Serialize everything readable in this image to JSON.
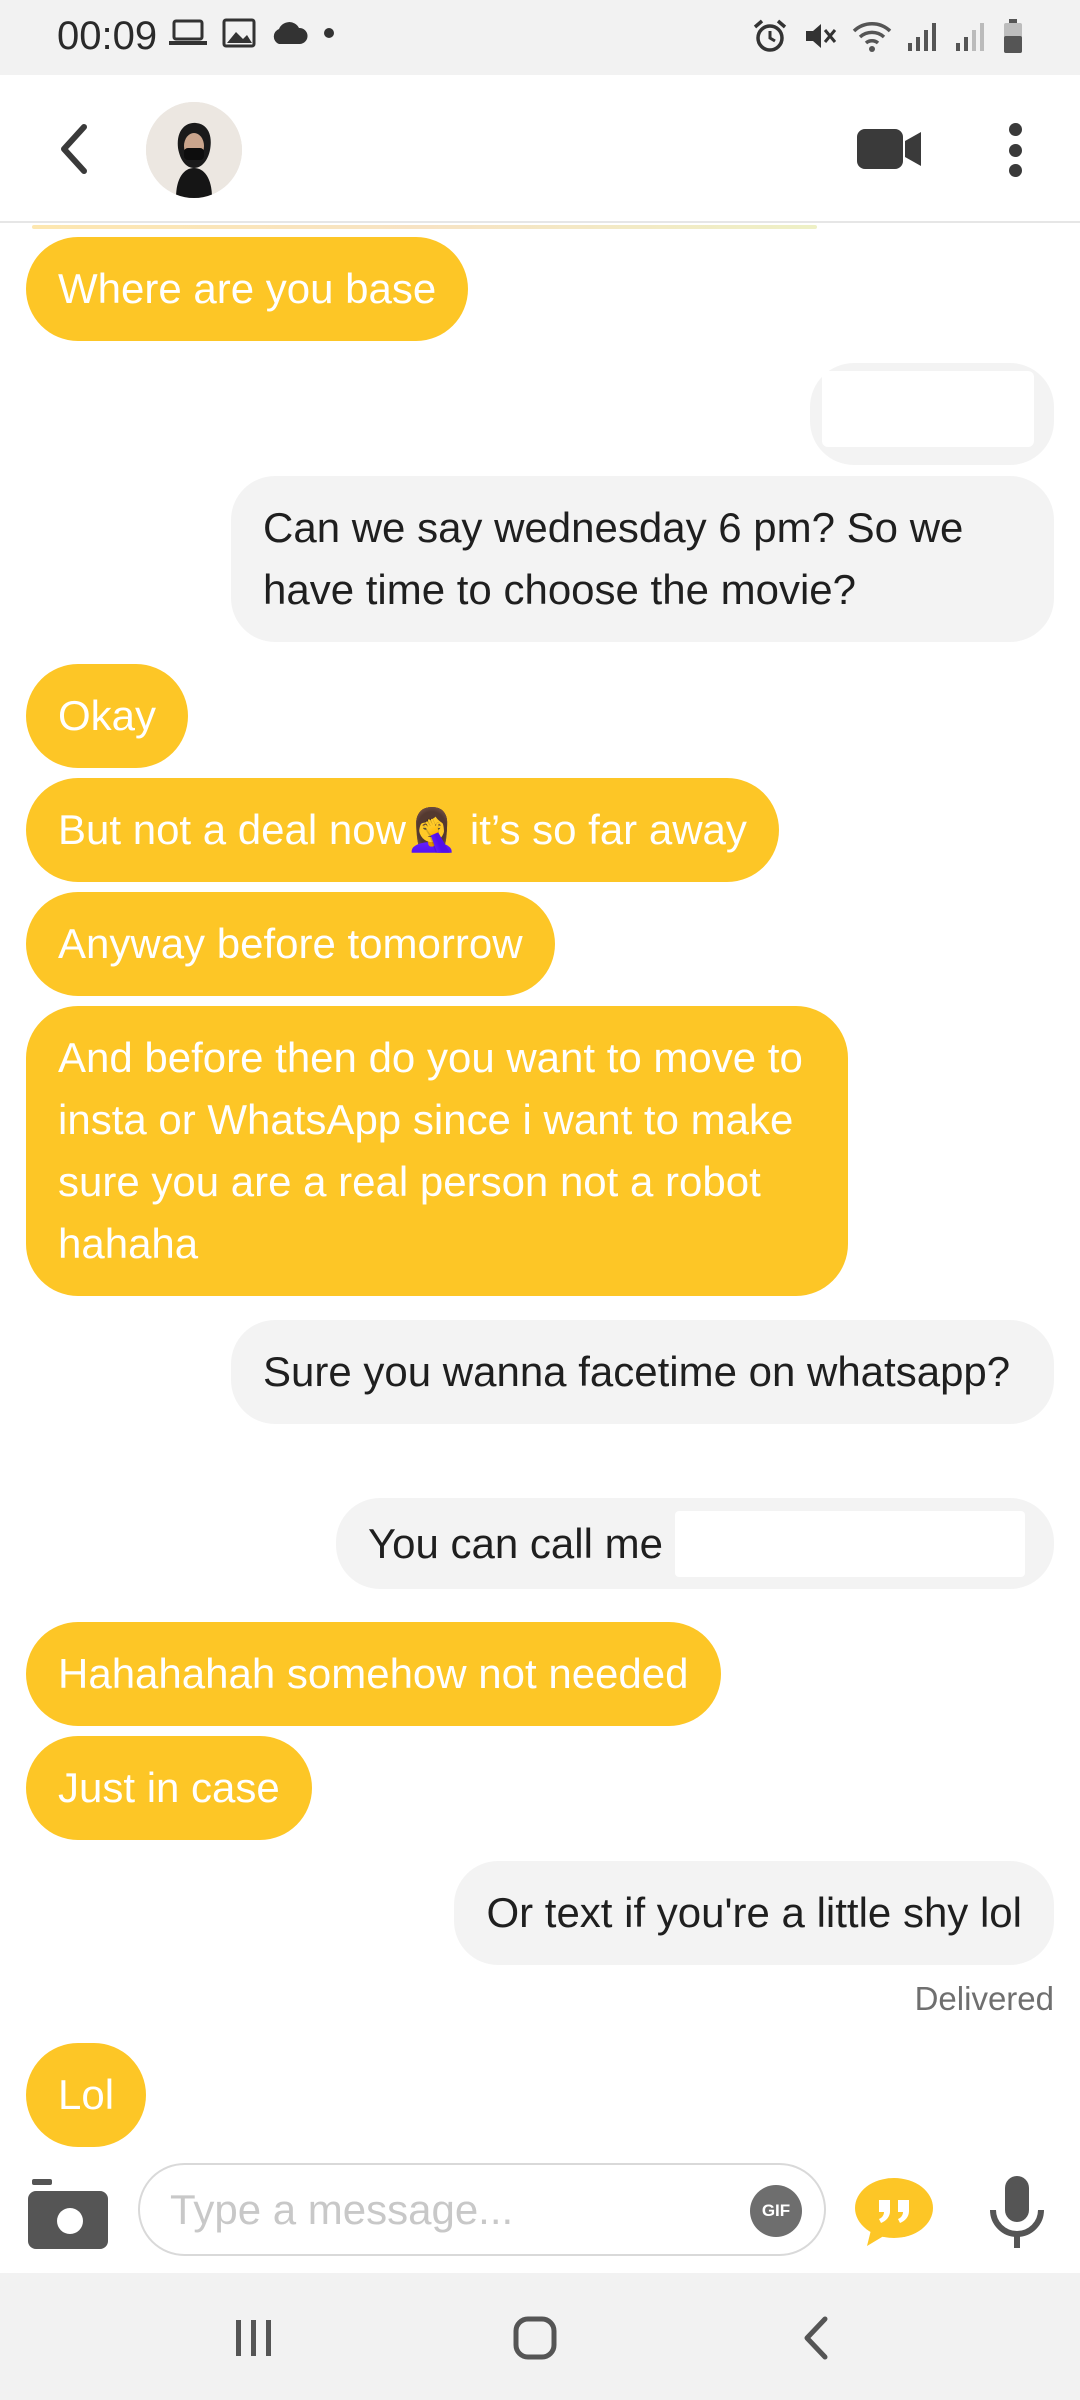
{
  "status_bar": {
    "time": "00:09",
    "left_icons": [
      "laptop-icon",
      "image-icon",
      "cloud-icon",
      "dot-icon"
    ],
    "right_icons": [
      "alarm-icon",
      "mute-icon",
      "wifi-icon",
      "signal-icon",
      "signal-icon",
      "battery-icon"
    ]
  },
  "header": {
    "back_icon": "chevron-left-icon",
    "avatar_alt": "profile photo",
    "video_icon": "video-camera-icon",
    "more_icon": "more-vertical-icon"
  },
  "messages": [
    {
      "direction": "in",
      "text": "Where are you base"
    },
    {
      "direction": "out",
      "text": "",
      "redacted": true
    },
    {
      "direction": "out",
      "text": "Can we say wednesday 6 pm? So we have time to choose the movie?"
    },
    {
      "direction": "in",
      "text": "Okay"
    },
    {
      "direction": "in",
      "text": "But not a deal now",
      "emoji": "🤦‍♀️",
      "text_after": " it’s so far away"
    },
    {
      "direction": "in",
      "text": "Anyway before tomorrow"
    },
    {
      "direction": "in",
      "text": "And before then do you want to move to insta or WhatsApp since i want to make sure you are a real person not a robot hahaha"
    },
    {
      "direction": "out",
      "text": "Sure you wanna facetime on whatsapp?"
    },
    {
      "direction": "out",
      "text": "You can call me ",
      "redacted_suffix": true
    },
    {
      "direction": "in",
      "text": "Hahahahah somehow not needed"
    },
    {
      "direction": "in",
      "text": "Just in case"
    },
    {
      "direction": "out",
      "text": "Or text if you're a little shy lol"
    },
    {
      "direction": "in",
      "text": "Lol"
    }
  ],
  "delivered_label": "Delivered",
  "composer": {
    "placeholder": "Type a message...",
    "gif_label": "GIF",
    "camera_icon": "camera-icon",
    "quote_icon": "quote-bubble-icon",
    "mic_icon": "microphone-icon"
  },
  "colors": {
    "incoming_bubble": "#fdc626",
    "outgoing_bubble": "#f3f3f3",
    "accent": "#fdc626"
  },
  "nav_bar": {
    "icons": [
      "recent-apps-icon",
      "home-icon",
      "back-icon"
    ]
  }
}
